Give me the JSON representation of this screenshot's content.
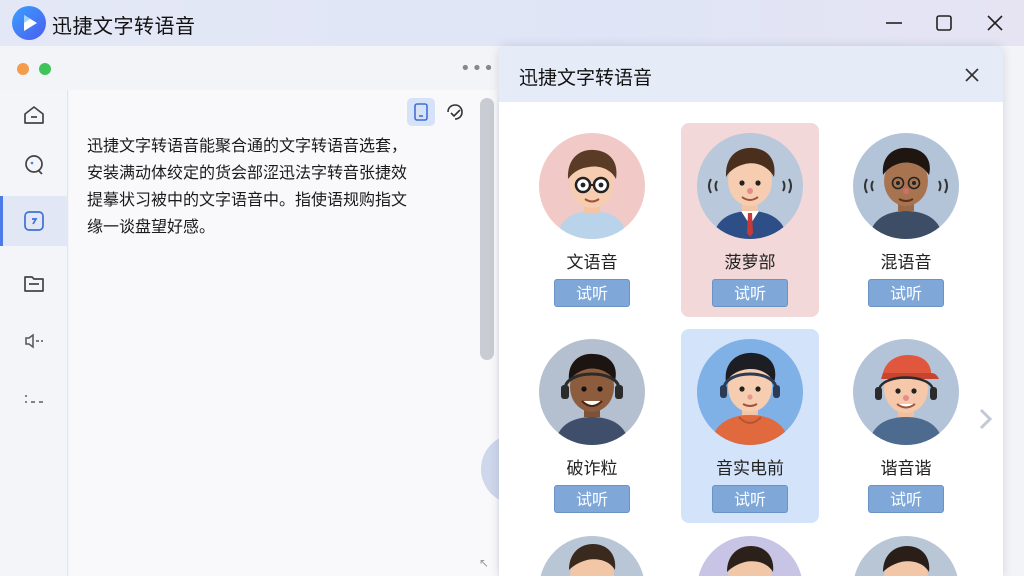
{
  "app": {
    "title": "迅捷文字转语音"
  },
  "colors": {
    "accent": "#4a7be8",
    "button": "#7fa7d8",
    "selected_pink": "#f2d8d8",
    "selected_blue": "#d3e3f9"
  },
  "window_controls": [
    "minimize-icon",
    "maximize-icon",
    "close-icon"
  ],
  "sidebar": {
    "items": [
      {
        "icon": "home-icon"
      },
      {
        "icon": "chat-icon"
      },
      {
        "icon": "text-to-speech-icon",
        "active": true
      },
      {
        "icon": "folder-icon"
      },
      {
        "icon": "speaker-icon"
      },
      {
        "icon": "settings-dash-icon"
      }
    ]
  },
  "editor": {
    "text": "迅捷文字转语音能聚合通的文字转语音选套，\n安装满动体绞定的货会部涩迅法字转音张捷效\n提摹状习被中的文字语音中。指使语规购指文\n缘一谈盘望好感。"
  },
  "panel": {
    "title": "迅捷文字转语音",
    "listen_label": "试听",
    "voices": [
      {
        "name": "文语音",
        "state": "normal"
      },
      {
        "name": "菠萝部",
        "state": "selected-pink"
      },
      {
        "name": "混语音",
        "state": "normal"
      },
      {
        "name": "破诈粒",
        "state": "normal"
      },
      {
        "name": "音实电前",
        "state": "selected-blue"
      },
      {
        "name": "谐音谐",
        "state": "normal"
      }
    ]
  }
}
